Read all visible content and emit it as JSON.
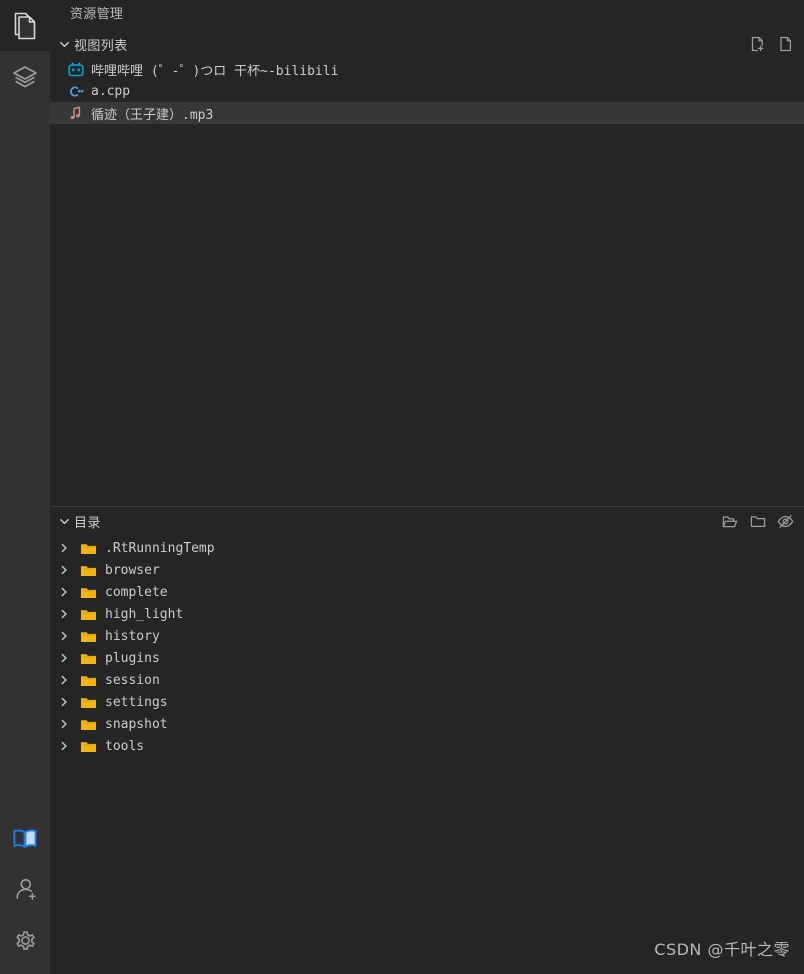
{
  "theme": {
    "activity_bar_bg": "#323233",
    "panel_bg": "#252526",
    "selected_row_bg": "#37373a",
    "text": "#cccccc",
    "muted_text": "#bbbbbb",
    "folder_color": "#f3b513",
    "bilibili_blue": "#00a1d6",
    "cpp_blue": "#5599d6",
    "music_pink": "#cf8b7a",
    "book_blue": "#1e7ce8",
    "icon_gray": "#8a8a8a"
  },
  "activity_bar": {
    "top_items": [
      {
        "name": "files-icon",
        "title": "资源管理",
        "active": true
      },
      {
        "name": "layers-icon",
        "title": "图层",
        "active": false
      }
    ],
    "bottom_items": [
      {
        "name": "book-icon",
        "title": "文档",
        "active": false
      },
      {
        "name": "add-user-icon",
        "title": "账户",
        "active": false
      },
      {
        "name": "gear-icon",
        "title": "设置",
        "active": false
      }
    ]
  },
  "panel": {
    "title": "资源管理"
  },
  "view_list_section": {
    "label": "视图列表",
    "expanded": true,
    "actions": [
      {
        "name": "new-file-icon",
        "title": "新建文件"
      },
      {
        "name": "file-icon",
        "title": "文件"
      }
    ],
    "items": [
      {
        "label": "哔哩哔哩 (゜-゜)つロ 干杯~-bilibili",
        "icon": "bilibili-icon",
        "selected": false
      },
      {
        "label": "a.cpp",
        "icon": "cpp-icon",
        "selected": false
      },
      {
        "label": "循迹（王子建）.mp3",
        "icon": "music-note-icon",
        "selected": true
      }
    ]
  },
  "directory_section": {
    "label": "目录",
    "expanded": true,
    "actions": [
      {
        "name": "new-folder-icon",
        "title": "新建文件夹"
      },
      {
        "name": "folder-icon",
        "title": "文件夹"
      },
      {
        "name": "eye-off-icon",
        "title": "隐藏"
      }
    ],
    "folders": [
      {
        "label": ".RtRunningTemp",
        "expanded": false
      },
      {
        "label": "browser",
        "expanded": false
      },
      {
        "label": "complete",
        "expanded": false
      },
      {
        "label": "high_light",
        "expanded": false
      },
      {
        "label": "history",
        "expanded": false
      },
      {
        "label": "plugins",
        "expanded": false
      },
      {
        "label": "session",
        "expanded": false
      },
      {
        "label": "settings",
        "expanded": false
      },
      {
        "label": "snapshot",
        "expanded": false
      },
      {
        "label": "tools",
        "expanded": false
      }
    ]
  },
  "watermark": {
    "text": "CSDN @千叶之零"
  }
}
